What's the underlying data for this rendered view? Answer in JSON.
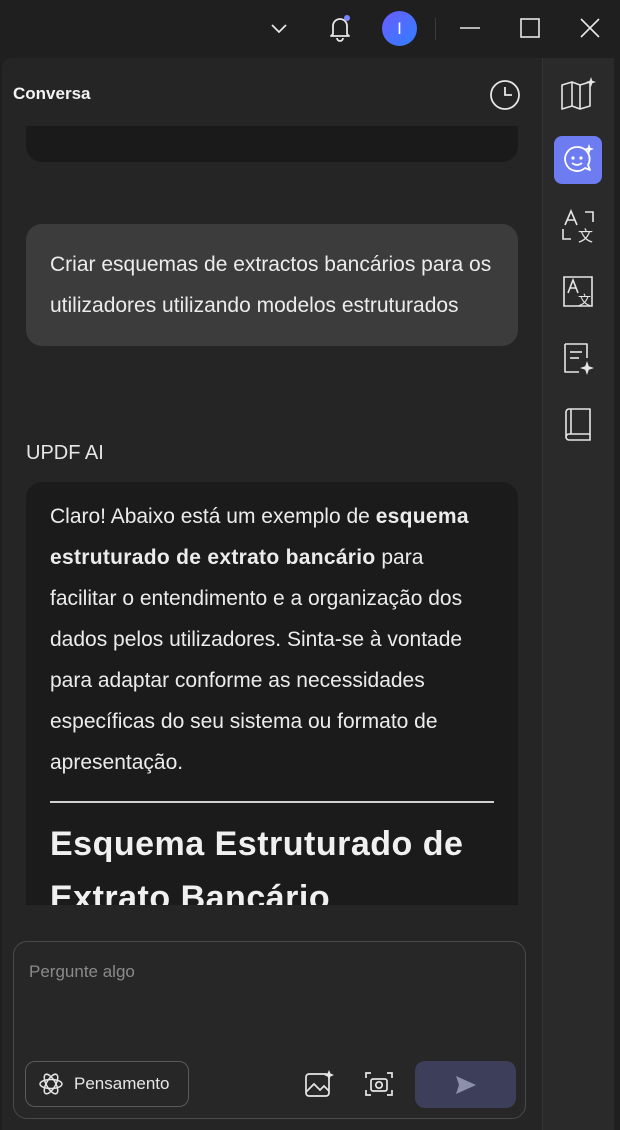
{
  "titlebar": {
    "avatar_letter": "I",
    "icons": [
      "chevron-down-icon",
      "bell-icon",
      "minimize-icon",
      "maximize-icon",
      "close-icon"
    ]
  },
  "header": {
    "title": "Conversa"
  },
  "chat": {
    "user_message": "Criar esquemas de extractos bancários para os utilizadores utilizando modelos estruturados",
    "ai_label": "UPDF AI",
    "ai_intro_1": "Claro! Abaixo está um exemplo de ",
    "ai_intro_bold": "esquema estruturado de extrato bancário",
    "ai_intro_2": " para facilitar o entendimento e a organização dos dados pelos utilizadores. Sinta-se à vontade para adaptar conforme as necessidades específicas do seu sistema ou formato de apresentação.",
    "ai_heading": "Esquema Estruturado de Extrato Bancário"
  },
  "input": {
    "placeholder": "Pergunte algo",
    "value": "",
    "thinking_label": "Pensamento"
  },
  "sidebar": {
    "items": [
      "book-ai-icon",
      "chat-ai-icon",
      "translate-icon",
      "translate-alt-icon",
      "summary-ai-icon",
      "notebook-icon"
    ],
    "active_index": 1
  },
  "colors": {
    "accent": "#6e7cf2",
    "send_button": "#3d3f5a",
    "background": "#1f1f1f"
  }
}
